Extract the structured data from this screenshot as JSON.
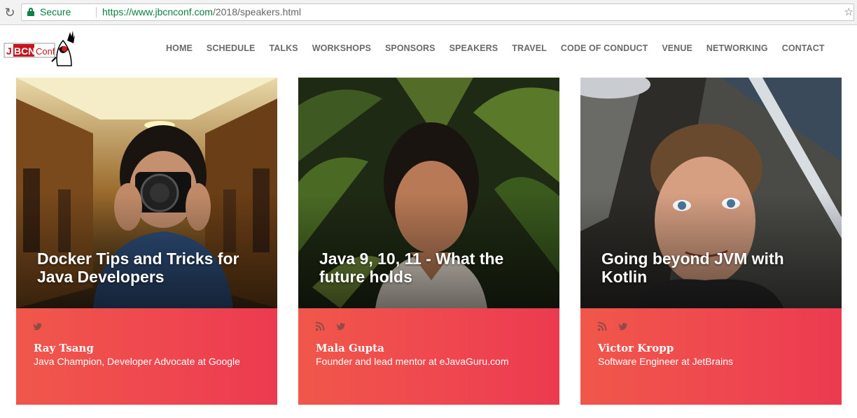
{
  "browser": {
    "secure_label": "Secure",
    "url_host": "https://www.jbcnconf.com",
    "url_path": "/2018/speakers.html"
  },
  "logo": {
    "text_j": "J",
    "text_bcn": "BCN",
    "text_conf": "Conf"
  },
  "nav": {
    "items": [
      "HOME",
      "SCHEDULE",
      "TALKS",
      "WORKSHOPS",
      "SPONSORS",
      "SPEAKERS",
      "TRAVEL",
      "CODE OF CONDUCT",
      "VENUE",
      "NETWORKING",
      "CONTACT"
    ]
  },
  "speakers": [
    {
      "talk_title": "Docker Tips and Tricks for Java Developers",
      "name": "Ray Tsang",
      "role": "Java Champion, Developer Advocate at Google",
      "social": [
        "twitter-icon"
      ]
    },
    {
      "talk_title": "Java 9, 10, 11 - What the future holds",
      "name": "Mala Gupta",
      "role": "Founder and lead mentor at eJavaGuru.com",
      "social": [
        "rss-icon",
        "twitter-icon"
      ]
    },
    {
      "talk_title": "Going beyond JVM with Kotlin",
      "name": "Victor Kropp",
      "role": "Software Engineer at JetBrains",
      "social": [
        "rss-icon",
        "twitter-icon"
      ]
    }
  ],
  "colors": {
    "accent": "#ef4650",
    "nav_text": "#6a6a6a",
    "secure_green": "#0b8043"
  }
}
